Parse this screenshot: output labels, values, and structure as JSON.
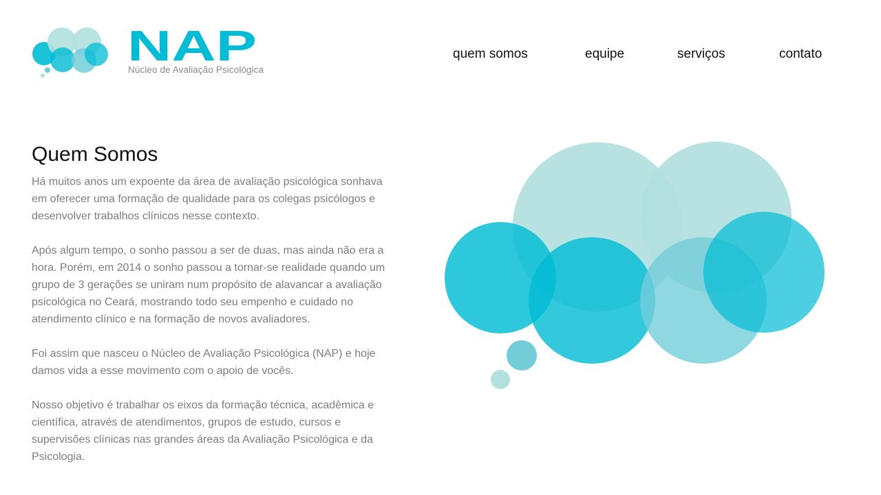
{
  "brand": {
    "name": "NAP",
    "tagline": "Núcleo de Avaliação Psicológica",
    "colors": {
      "primary": "#00bcd4",
      "mid": "#73cdd9",
      "light": "#b1e0de"
    }
  },
  "nav": {
    "items": [
      {
        "label": "quem somos"
      },
      {
        "label": "equipe"
      },
      {
        "label": "serviços"
      },
      {
        "label": "contato"
      }
    ]
  },
  "main": {
    "title": "Quem Somos",
    "paragraphs": [
      "Há muitos anos um expoente da área de avaliação psicológica sonhava em oferecer uma formação de qualidade para os colegas psicólogos e desenvolver trabalhos clínicos nesse contexto.",
      "Após algum tempo, o sonho passou a ser de duas, mas ainda não era a hora. Porém, em 2014 o sonho passou a tornar-se realidade quando um grupo de 3 gerações se uniram num propósito de alavancar a avaliação psicológica no Ceará, mostrando todo seu empenho e cuidado no atendimento clínico e na formação de novos avaliadores.",
      "Foi assim que nasceu o Núcleo de Avaliação Psicológica (NAP) e hoje damos vida a esse movimento com o apoio de vocês.",
      "Nosso objetivo é trabalhar os eixos da formação técnica, acadêmica e científica, através de atendimentos, grupos de estudo, cursos e supervisões clínicas nas grandes áreas da Avaliação Psicológica e da Psicologia."
    ]
  }
}
